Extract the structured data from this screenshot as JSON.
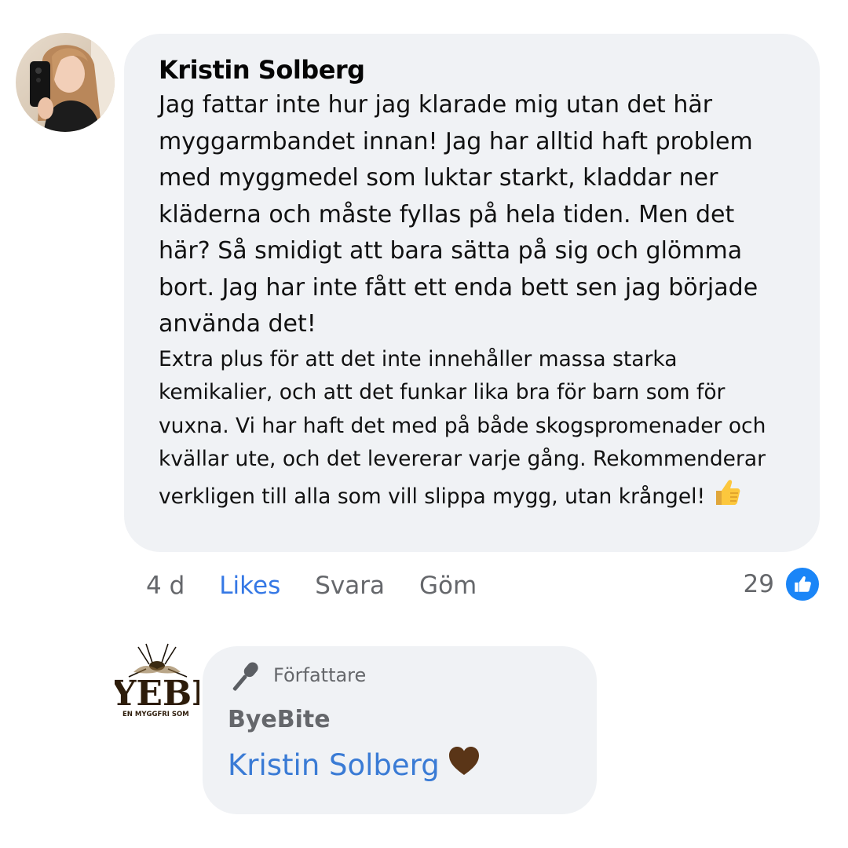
{
  "comment": {
    "author": "Kristin Solberg",
    "paragraph1": "Jag fattar inte hur jag klarade mig utan det här myggarmbandet innan! Jag har alltid haft problem med myggmedel som luktar starkt, kladdar ner kläderna och måste fyllas på hela tiden. Men det här? Så smidigt att bara sätta på sig och glömma bort. Jag har inte fått ett enda bett sen jag började använda det!",
    "paragraph2": "Extra plus för att det inte innehåller massa starka kemikalier, och att det funkar lika bra för barn som för vuxna. Vi har haft det med på både skogspromenader och kvällar ute, och det levererar varje gång. Rekommenderar verkligen till alla som vill slippa mygg, utan krångel!",
    "emoji_icon": "thumbs-up-emoji"
  },
  "actions": {
    "time": "4 d",
    "like": "Likes",
    "reply": "Svara",
    "hide": "Göm"
  },
  "reactions": {
    "count": "29",
    "icon": "like-reaction-icon",
    "badge_color": "#1a85f7"
  },
  "reply": {
    "badge_label": "Författare",
    "badge_icon": "microphone-icon",
    "author": "ByeBite",
    "text": "Kristin Solberg",
    "emoji_icon": "brown-heart-emoji",
    "logo_text": "YEBIT",
    "logo_subtext": "EN MYGGFRI SOM"
  },
  "colors": {
    "bubble_bg": "#f0f2f5",
    "link_blue": "#3578e5",
    "secondary_text": "#65676b"
  }
}
